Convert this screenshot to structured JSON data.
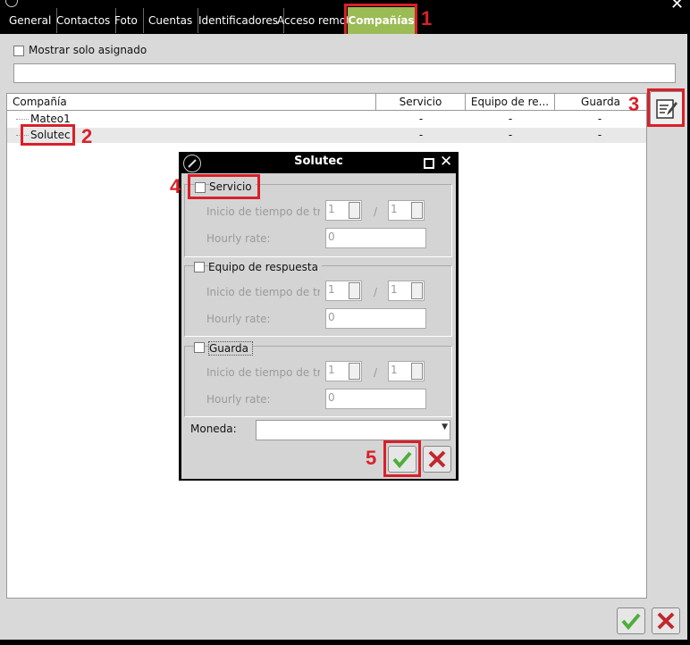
{
  "tabs": [
    {
      "label": "General"
    },
    {
      "label": "Contactos"
    },
    {
      "label": "Foto"
    },
    {
      "label": "Cuentas"
    },
    {
      "label": "Identificadores"
    },
    {
      "label": "Acceso remoto"
    },
    {
      "label": "Compañías"
    }
  ],
  "filter": {
    "checkbox_label": "Mostrar solo asignado",
    "value": ""
  },
  "table": {
    "columns": [
      "Compañía",
      "Servicio",
      "Equipo de re...",
      "Guarda"
    ],
    "rows": [
      {
        "name": "Mateo1",
        "servicio": "-",
        "equipo": "-",
        "guarda": "-"
      },
      {
        "name": "Solutec",
        "servicio": "-",
        "equipo": "-",
        "guarda": "-"
      }
    ]
  },
  "dialog": {
    "title": "Solutec",
    "sections": [
      {
        "label": "Servicio",
        "start_label": "Inicio de tiempo de tra",
        "spin1": "1",
        "spin2": "1",
        "slash": "/",
        "rate_label": "Hourly rate:",
        "rate": "0"
      },
      {
        "label": "Equipo de respuesta",
        "start_label": "Inicio de tiempo de tra",
        "spin1": "1",
        "spin2": "1",
        "slash": "/",
        "rate_label": "Hourly rate:",
        "rate": "0"
      },
      {
        "label": "Guarda",
        "start_label": "Inicio de tiempo de tra",
        "spin1": "1",
        "spin2": "1",
        "slash": "/",
        "rate_label": "Hourly rate:",
        "rate": "0"
      }
    ],
    "currency_label": "Moneda:",
    "currency_value": ""
  },
  "markers": [
    "1",
    "2",
    "3",
    "4",
    "5"
  ],
  "colors": {
    "active_tab": "#9bbb54",
    "highlight": "#d9202a",
    "ok": "#4caf3a",
    "cancel": "#c0282e"
  }
}
